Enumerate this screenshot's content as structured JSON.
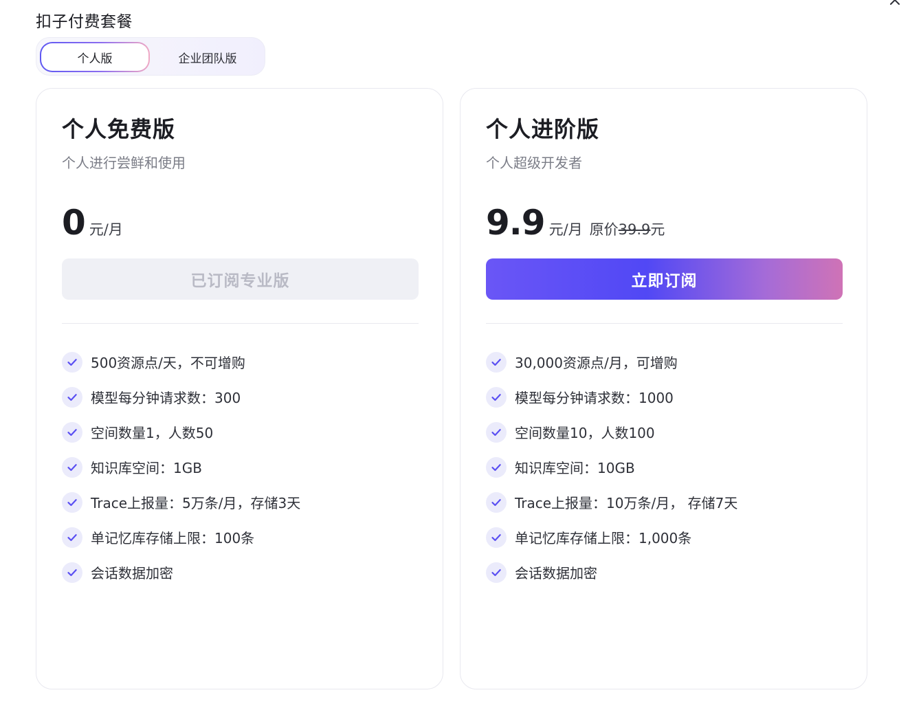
{
  "modal": {
    "title": "扣子付费套餐",
    "close_icon": "close-icon"
  },
  "tabs": [
    {
      "label": "个人版",
      "active": true
    },
    {
      "label": "企业团队版",
      "active": false
    }
  ],
  "plans": [
    {
      "title": "个人免费版",
      "subtitle": "个人进行尝鲜和使用",
      "price": "0",
      "price_unit": "元/月",
      "button_label": "已订阅专业版",
      "button_disabled": true,
      "features": [
        "500资源点/天，不可增购",
        "模型每分钟请求数：300",
        "空间数量1，人数50",
        "知识库空间：1GB",
        "Trace上报量：5万条/月，存储3天",
        "单记忆库存储上限：100条",
        "会话数据加密"
      ]
    },
    {
      "title": "个人进阶版",
      "subtitle": "个人超级开发者",
      "price": "9.9",
      "price_unit": "元/月",
      "original_label": "原价",
      "original_value": "39.9",
      "original_suffix": "元",
      "button_label": "立即订阅",
      "button_disabled": false,
      "features": [
        "30,000资源点/月，可增购",
        "模型每分钟请求数：1000",
        "空间数量10，人数100",
        "知识库空间：10GB",
        "Trace上报量：10万条/月， 存储7天",
        "单记忆库存储上限：1,000条",
        "会话数据加密"
      ]
    }
  ],
  "colors": {
    "accent": "#5148f5",
    "check_bg": "#ebebfb",
    "check_mark": "#5a4ff2"
  }
}
